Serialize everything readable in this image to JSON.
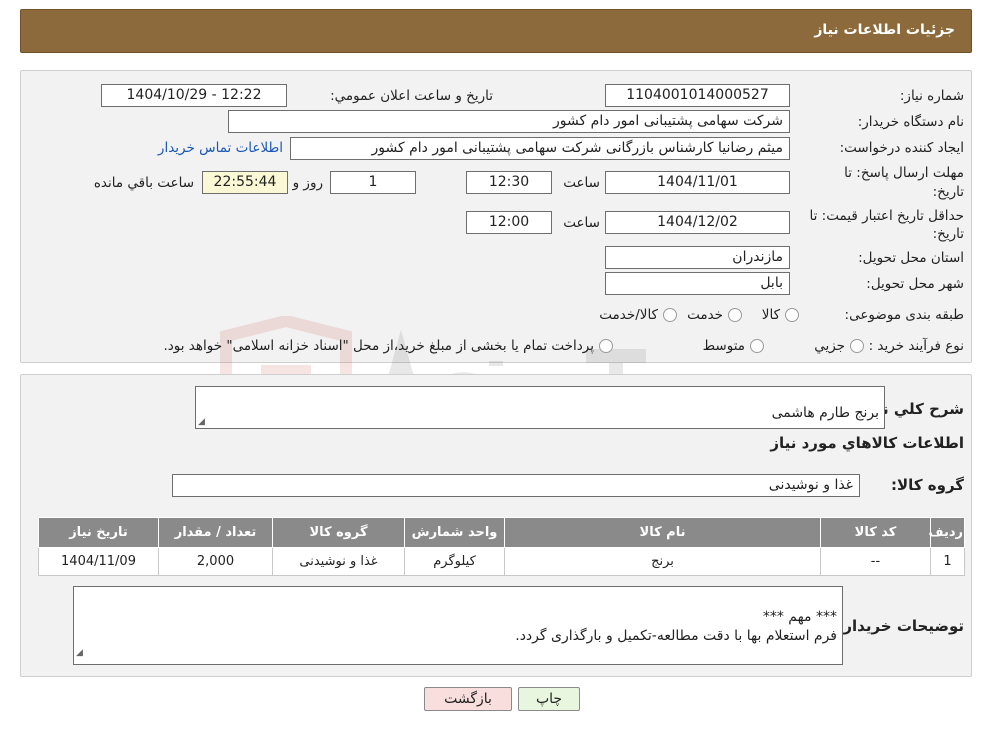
{
  "header": {
    "title": "جزئیات اطلاعات نیاز"
  },
  "form": {
    "need_number_label": "شماره نیاز:",
    "need_number": "1104001014000527",
    "announce_label": "تاریخ و ساعت اعلان عمومي:",
    "announce_value": "1404/10/29 - 12:22",
    "buyer_org_label": "نام دستگاه خریدار:",
    "buyer_org": "شرکت سهامی پشتیبانی امور دام کشور",
    "requester_label": "ایجاد کننده درخواست:",
    "requester": "میثم رضانیا کارشناس بازرگانی شرکت سهامی پشتیبانی امور دام کشور",
    "contact_link": "اطلاعات تماس خریدار",
    "deadline_label_1": "مهلت ارسال پاسخ: تا",
    "deadline_label_2": "تاریخ:",
    "deadline_date": "1404/11/01",
    "time_label": "ساعت",
    "deadline_time": "12:30",
    "days_value": "1",
    "days_label": "روز و",
    "remaining_time": "22:55:44",
    "remaining_label": "ساعت باقي مانده",
    "validity_label_1": "حداقل تاریخ اعتبار قیمت: تا",
    "validity_label_2": "تاریخ:",
    "validity_date": "1404/12/02",
    "validity_time": "12:00",
    "province_label": "استان محل تحویل:",
    "province": "مازندران",
    "city_label": "شهر محل تحویل:",
    "city": "بابل",
    "category_label": "طبقه بندی موضوعی:",
    "category_options": [
      "کالا",
      "خدمت",
      "کالا/خدمت"
    ],
    "process_label": "نوع فرآیند خرید :",
    "process_options": [
      "جزيي",
      "متوسط"
    ],
    "process_note": "پرداخت تمام یا بخشی از مبلغ خرید،از محل \"اسناد خزانه اسلامی\" خواهد بود."
  },
  "details": {
    "summary_label": "شرح کلي نیاز:",
    "summary": "برنج طارم هاشمی",
    "items_heading": "اطلاعات کالاهاي مورد نیاز",
    "group_label": "گروه کالا:",
    "group": "غذا و نوشیدنی",
    "table": {
      "headers": [
        "ردیف",
        "کد کالا",
        "نام کالا",
        "واحد شمارش",
        "گروه کالا",
        "تعداد / مقدار",
        "تاریخ نیاز"
      ],
      "rows": [
        [
          "1",
          "--",
          "برنج",
          "کیلوگرم",
          "غذا و نوشیدنی",
          "2,000",
          "1404/11/09"
        ]
      ]
    },
    "buyer_notes_label": "توضیحات خریدار:",
    "buyer_notes": "*** مهم ***\nفرم استعلام بها با دقت مطالعه-تکمیل و بارگذاری گردد."
  },
  "buttons": {
    "print": "چاپ",
    "back": "بازگشت"
  },
  "colors": {
    "header_bg": "#8c6a3b",
    "link": "#1a57b8",
    "back_btn": "#f9dede",
    "print_btn": "#e8f6df"
  }
}
